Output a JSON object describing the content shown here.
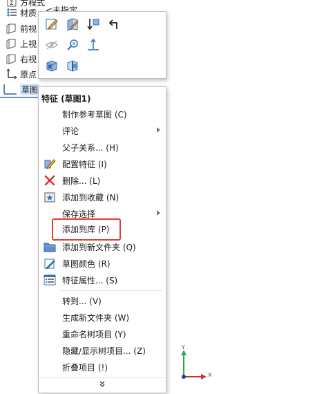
{
  "tree": {
    "items": [
      {
        "label": "方程式",
        "icon": "equation-icon"
      },
      {
        "label": "材质",
        "icon": "material-icon"
      },
      {
        "label": "前视",
        "icon": "plane-icon"
      },
      {
        "label": "上视",
        "icon": "plane-icon"
      },
      {
        "label": "右视",
        "icon": "plane-icon"
      },
      {
        "label": "原点",
        "icon": "origin-icon"
      },
      {
        "label": "草图",
        "icon": "sketch-icon"
      }
    ],
    "partial_text": "<未指定"
  },
  "toolbar": {
    "buttons": [
      "edit-sketch-icon",
      "edit-feature-icon",
      "rollback-icon",
      "undo-arrow-icon",
      "hide-eye-icon",
      "zoom-to-selection-icon",
      "normal-to-icon",
      "view-orientation-icon",
      "section-view-icon"
    ]
  },
  "menu": {
    "header": "特征 (草图1)",
    "items": [
      {
        "label": "制作参考草图 (C)",
        "icon": "",
        "submenu": false
      },
      {
        "label": "评论",
        "icon": "",
        "submenu": true
      },
      {
        "label": "父子关系... (H)",
        "icon": "",
        "submenu": false
      },
      {
        "label": "配置特征 (I)",
        "icon": "configure-feature-icon",
        "submenu": false
      },
      {
        "label": "删除... (L)",
        "icon": "delete-x-icon",
        "submenu": false
      },
      {
        "label": "添加到收藏 (N)",
        "icon": "favorite-star-icon",
        "submenu": false
      },
      {
        "label": "保存选择",
        "icon": "",
        "submenu": true
      },
      {
        "label": "添加到库 (P)",
        "icon": "",
        "submenu": false
      },
      {
        "label": "添加到新文件夹 (Q)",
        "icon": "folder-icon",
        "submenu": false
      },
      {
        "label": "草图颜色 (R)",
        "icon": "sketch-color-icon",
        "submenu": false
      },
      {
        "label": "特征属性... (S)",
        "icon": "properties-icon",
        "submenu": false
      },
      {
        "label": "转到... (V)",
        "icon": "",
        "submenu": false
      },
      {
        "label": "生成新文件夹 (W)",
        "icon": "",
        "submenu": false
      },
      {
        "label": "重命名树项目 (Y)",
        "icon": "",
        "submenu": false
      },
      {
        "label": "隐藏/显示树项目... (Z)",
        "icon": "",
        "submenu": false
      },
      {
        "label": "折叠项目 (!)",
        "icon": "",
        "submenu": false
      }
    ],
    "more": "⌄⌄"
  },
  "triad": {
    "x_label": "X",
    "y_label": "Y"
  },
  "colors": {
    "highlight": "#e03f2f",
    "selection": "#cfe6fb",
    "accent": "#5b8fd6"
  }
}
